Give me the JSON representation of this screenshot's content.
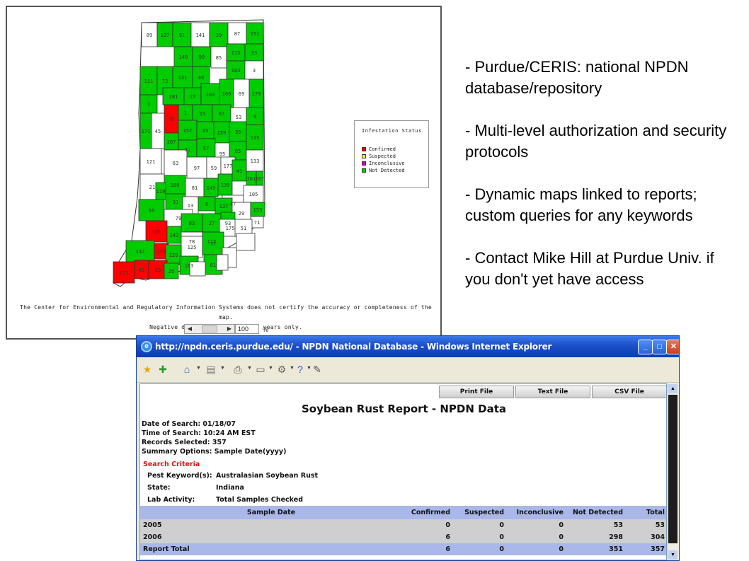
{
  "map": {
    "county_labels": [
      "89",
      "127",
      "91",
      "141",
      "39",
      "87",
      "151",
      "149",
      "99",
      "85",
      "113",
      "33",
      "111",
      "73",
      "131",
      "49",
      "183",
      "3",
      "7",
      "181",
      "17",
      "103",
      "169",
      "69",
      "179",
      "1",
      "15",
      "67",
      "53",
      "9",
      "75",
      "157",
      "23",
      "159",
      "35",
      "171",
      "45",
      "107",
      "11",
      "57",
      "95",
      "135",
      "65",
      "121",
      "63",
      "97",
      "59",
      "177",
      "133",
      "109",
      "81",
      "145",
      "139",
      "41",
      "161",
      "167",
      "21",
      "119",
      "31",
      "47",
      "105",
      "13",
      "5",
      "137",
      "29",
      "153",
      "55",
      "79",
      "93",
      "71",
      "83",
      "27",
      "101",
      "143",
      "78",
      "117",
      "175",
      "51",
      "125",
      "37",
      "147",
      "173",
      "129",
      "163",
      "61",
      "123",
      "43",
      "19",
      "25"
    ],
    "legend": {
      "title": "Infestation Status",
      "items": [
        {
          "label": "Confirmed",
          "color": "#ff0000"
        },
        {
          "label": "Suspected",
          "color": "#ffff00"
        },
        {
          "label": "Inconclusive",
          "color": "#cc00cc"
        },
        {
          "label": "Not Detected",
          "color": "#00cc00"
        }
      ]
    },
    "disclaimer_line1": "The Center for Environmental and Regulatory Information Systems does not certify the accuracy or completeness of the map.",
    "disclaimer_line2": "Negative data spans over last 3 years only.",
    "zoom_value": "100",
    "zoom_unit": "%",
    "colors": {
      "confirmed": "#ff0000",
      "not_detected": "#00cc00",
      "none": "#ffffff"
    }
  },
  "bullets": [
    "- Purdue/CERIS: national NPDN database/repository",
    "- Multi-level authorization and security protocols",
    "- Dynamic maps linked to reports; custom queries for any keywords",
    "- Contact Mike Hill at Purdue Univ. if you don't yet have access"
  ],
  "browser": {
    "title": "http://npdn.ceris.purdue.edu/ - NPDN National Database - Windows Internet Explorer",
    "icons": [
      "favorites-star-icon",
      "add-favorites-icon",
      "home-icon",
      "feeds-icon",
      "print-icon",
      "page-icon",
      "tools-icon",
      "help-icon",
      "research-icon"
    ]
  },
  "report": {
    "buttons": {
      "print": "Print File",
      "text": "Text File",
      "csv": "CSV File"
    },
    "title": "Soybean Rust Report - NPDN Data",
    "date_of_search": "Date of Search: 01/18/07",
    "time_of_search": "Time of Search: 10:24 AM EST",
    "records_selected": "Records Selected: 357",
    "summary_options": "Summary Options: Sample Date(yyyy)",
    "criteria_header": "Search Criteria",
    "criteria": [
      {
        "key": "Pest Keyword(s):",
        "value": "Australasian Soybean Rust"
      },
      {
        "key": "State:",
        "value": "Indiana"
      },
      {
        "key": "Lab Activity:",
        "value": "Total Samples Checked"
      }
    ],
    "columns": [
      "Sample Date",
      "Confirmed",
      "Suspected",
      "Inconclusive",
      "Not Detected",
      "Total"
    ],
    "rows": [
      [
        "2005",
        "0",
        "0",
        "0",
        "53",
        "53"
      ],
      [
        "2006",
        "6",
        "0",
        "0",
        "298",
        "304"
      ]
    ],
    "total_row": [
      "Report Total",
      "6",
      "0",
      "0",
      "351",
      "357"
    ]
  }
}
